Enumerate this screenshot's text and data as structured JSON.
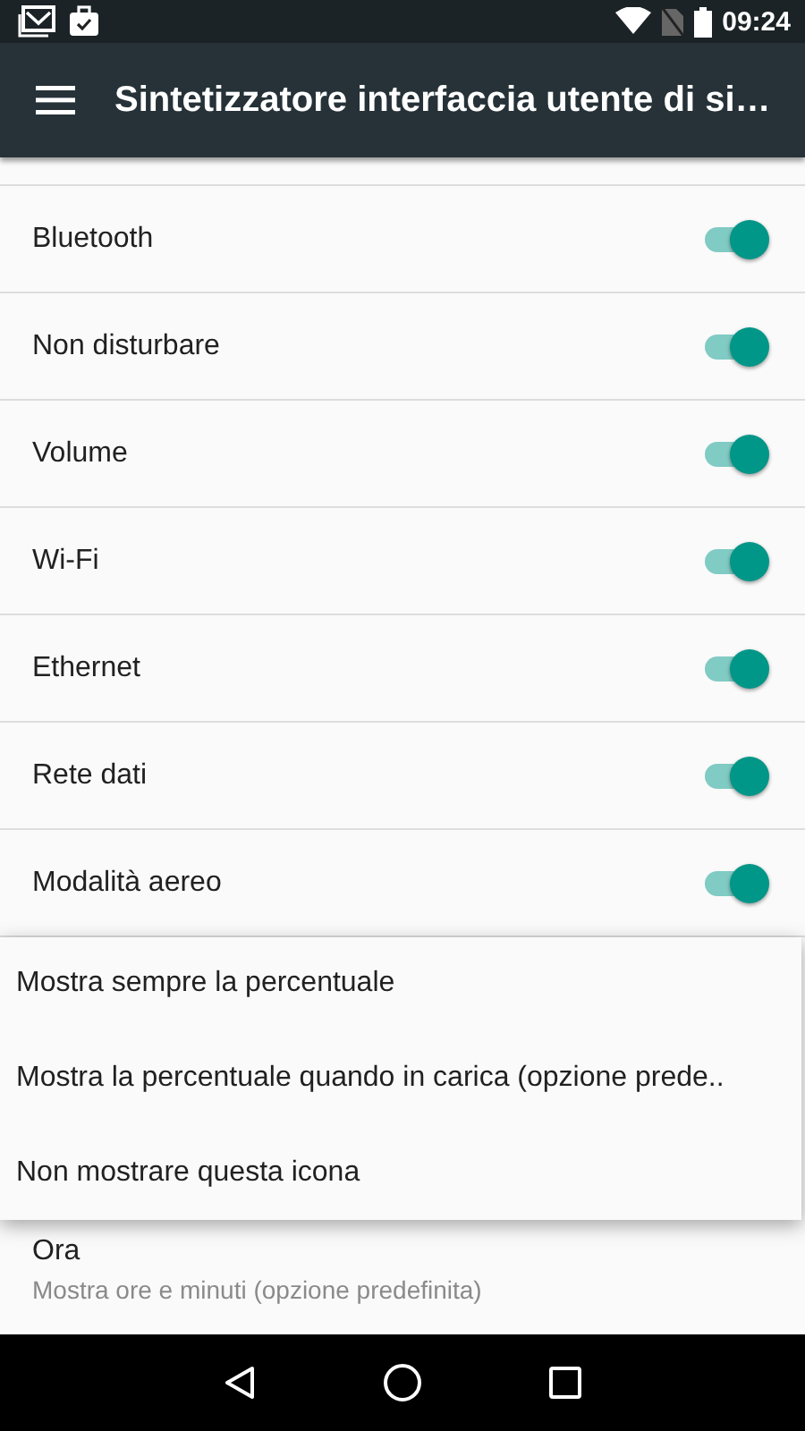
{
  "status_bar": {
    "time": "09:24"
  },
  "toolbar": {
    "title": "Sintetizzatore interfaccia utente di si…"
  },
  "toggles": [
    {
      "label": "Bluetooth",
      "on": true
    },
    {
      "label": "Non disturbare",
      "on": true
    },
    {
      "label": "Volume",
      "on": true
    },
    {
      "label": "Wi-Fi",
      "on": true
    },
    {
      "label": "Ethernet",
      "on": true
    },
    {
      "label": "Rete dati",
      "on": true
    },
    {
      "label": "Modalità aereo",
      "on": true
    }
  ],
  "popup_menu": {
    "items": [
      "Mostra sempre la percentuale",
      "Mostra la percentuale quando in carica (opzione prede..",
      "Non mostrare questa icona"
    ]
  },
  "setting": {
    "title": "Ora",
    "summary": "Mostra ore e minuti (opzione predefinita)"
  }
}
